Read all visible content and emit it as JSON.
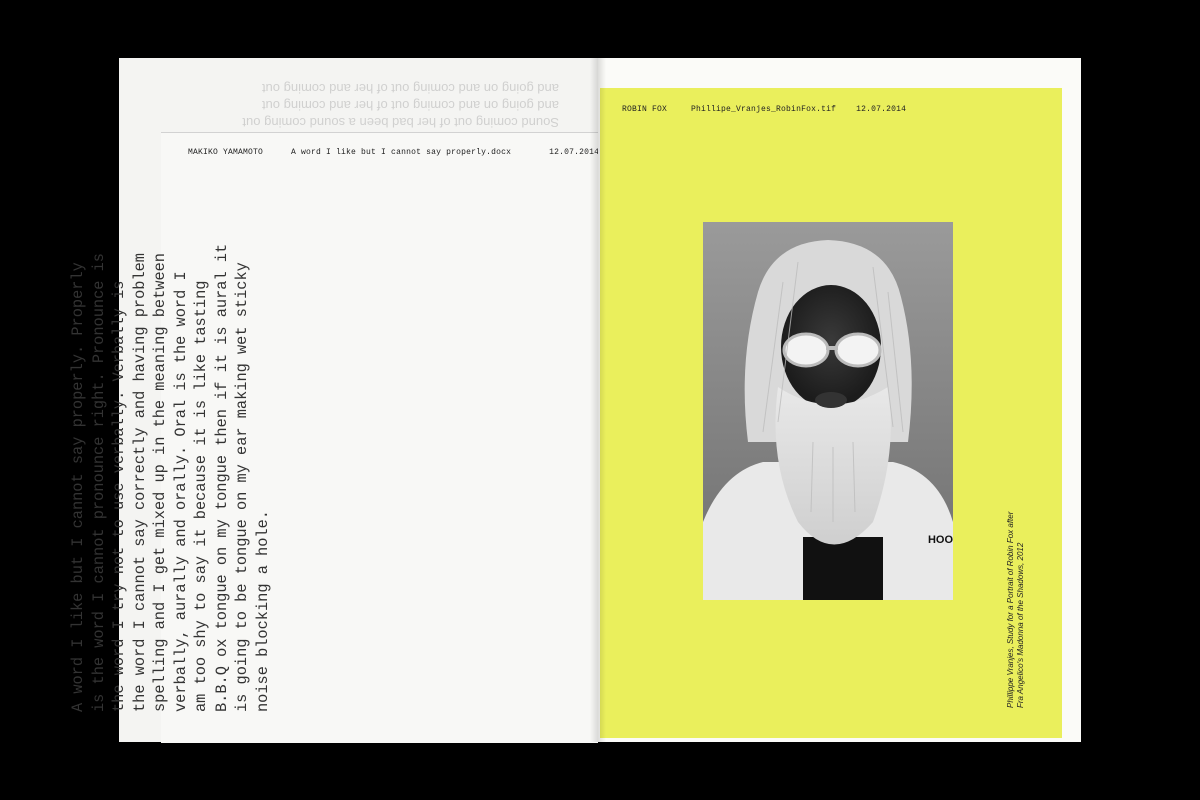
{
  "left_page": {
    "header": {
      "author": "MAKIKO YAMAMOTO",
      "filename": "A word I like but I cannot say properly.docx",
      "date": "12.07.2014"
    },
    "bleed_through_lines": [
      "Sound coming out of her bad been a sound coming out",
      "and going on and coming out of her and coming out",
      "and going on and coming out of her and coming out"
    ],
    "body_lines": [
      "A word I like but I cannot say properly. Properly",
      "is the word I cannot pronounce right. Pronounce is",
      "the word I try not to use verbally. Verbally is",
      "the word I cannot say correctly and having problem",
      "spelling and I get mixed up in the meaning between",
      "verbally, aurally and orally. Oral is the word I",
      "am too shy to say it because it is like tasting",
      "B.B.Q ox tongue on my tongue then if it is aural it",
      "is going to be tongue on my ear making wet sticky",
      "noise blocking a hole."
    ]
  },
  "right_page": {
    "header": {
      "author": "ROBIN FOX",
      "filename": "Phillipe_Vranjes_RobinFox.tif",
      "date": "12.07.2014"
    },
    "shirt_text": "HOO",
    "caption_lines": [
      "Phillippe Vranjes, Study for a Portrait of Robin Fox after",
      "Fra Angelico's Madonna of the Shadows, 2012"
    ]
  },
  "colors": {
    "background": "#000000",
    "paper": "#f4f4f2",
    "accent_yellow": "#eaef5c"
  }
}
